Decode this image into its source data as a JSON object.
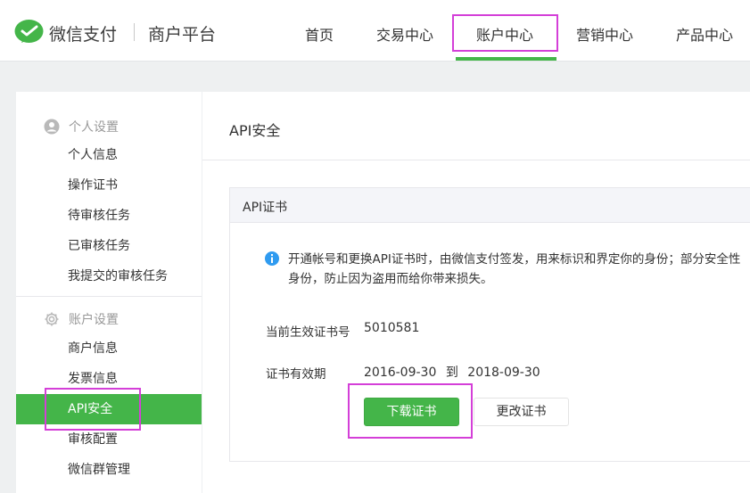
{
  "header": {
    "brand": "微信支付",
    "brand_sub": "商户平台",
    "logo_icon": "wechat-pay-logo-icon",
    "nav": [
      {
        "label": "首页"
      },
      {
        "label": "交易中心"
      },
      {
        "label": "账户中心",
        "active": true
      },
      {
        "label": "营销中心"
      },
      {
        "label": "产品中心"
      }
    ]
  },
  "sidebar": {
    "groups": [
      {
        "title": "个人设置",
        "icon": "user-icon",
        "items": [
          "个人信息",
          "操作证书",
          "待审核任务",
          "已审核任务",
          "我提交的审核任务"
        ]
      },
      {
        "title": "账户设置",
        "icon": "gear-icon",
        "items": [
          "商户信息",
          "发票信息",
          "API安全",
          "审核配置",
          "微信群管理"
        ],
        "active_item": "API安全"
      }
    ]
  },
  "main": {
    "title": "API安全",
    "panel": {
      "title": "API证书",
      "notice": {
        "icon": "info-icon",
        "line1": "开通帐号和更换API证书时，由微信支付签发，用来标识和界定你的身份；部分安全性",
        "line2": "身份，防止因为盗用而给你带来损失。"
      },
      "cert_number_label": "当前生效证书号",
      "cert_number": "5010581",
      "validity_label": "证书有效期",
      "validity_start": "2016-09-30",
      "validity_to": "到",
      "validity_end": "2018-09-30",
      "download_button": "下载证书",
      "change_button": "更改证书"
    }
  },
  "colors": {
    "accent": "#44b549",
    "highlight": "#d43fd8"
  }
}
